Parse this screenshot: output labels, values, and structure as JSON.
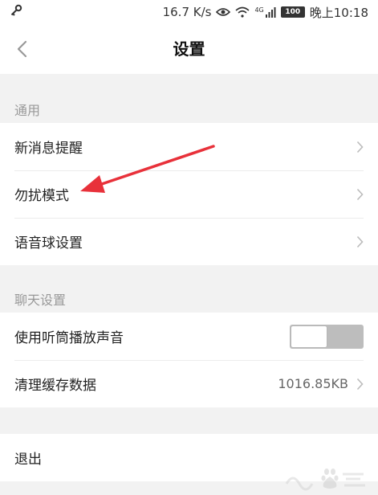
{
  "status_bar": {
    "network_speed": "16.7 K/s",
    "network_type": "4G",
    "battery": "100",
    "time": "晚上10:18",
    "icons": [
      "key-icon",
      "eye-icon",
      "wifi-icon",
      "signal-icon",
      "battery-icon"
    ]
  },
  "nav": {
    "title": "设置",
    "back_icon": "chevron-left-icon"
  },
  "sections": {
    "general": {
      "header": "通用",
      "items": [
        {
          "label": "新消息提醒"
        },
        {
          "label": "勿扰模式"
        },
        {
          "label": "语音球设置"
        }
      ]
    },
    "chat": {
      "header": "聊天设置",
      "earpiece": {
        "label": "使用听筒播放声音",
        "enabled": false
      },
      "cache": {
        "label": "清理缓存数据",
        "value": "1016.85KB"
      }
    },
    "logout": {
      "label": "退出"
    }
  },
  "colors": {
    "background": "#f2f2f2",
    "row_background": "#ffffff",
    "section_header": "#999999",
    "toggle_off": "#bdbdbd",
    "annotation_arrow": "#e8313a"
  }
}
